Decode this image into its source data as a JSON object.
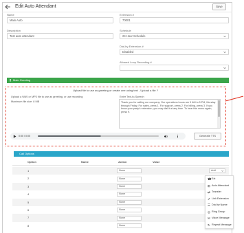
{
  "header": {
    "title": "Edit Auto Attendant",
    "back_icon": "arrow-left-icon",
    "save_label": "Save"
  },
  "form": {
    "name": {
      "label": "Name",
      "value": "Main Auto"
    },
    "description": {
      "label": "Description",
      "value": "Test auto attendant"
    },
    "extension": {
      "label": "Extension #",
      "value": "70001"
    },
    "schedule": {
      "label": "Schedule",
      "value": "24 Hour Schedule"
    },
    "dial_out": {
      "label": "Dial-by-Extension #",
      "value": "Disabled"
    },
    "loop": {
      "label": "Allowed Loop Recording #",
      "value": ""
    }
  },
  "greeting": {
    "bar_label": "Main Greeting",
    "intro": "Upload file to use as greeting or create one using text - Upload a file ?",
    "upload_hint": "Upload a WAV or MP3 file to use as greeting, or use recording",
    "max_size": "Maximum file size: 8 MB",
    "tts_label": "Enter Text-to-Speech",
    "tts_text": "Thank you for calling our company. Our operations hours are 9 AM to 5 PM, Monday through Friday. For sales, press 1. For support, press 2. For billing, press 3. If you know your party's extension, you may dial it at any time. To hear this menu again, press 9.",
    "player_time": "0:00 / 0:00",
    "generate_label": "Generate TTS"
  },
  "options": {
    "title": "Call Options",
    "columns": [
      "Option",
      "Name",
      "Action",
      "Value"
    ],
    "rows": [
      {
        "digit": "1",
        "action": "None"
      },
      {
        "digit": "2",
        "action": "None"
      },
      {
        "digit": "3",
        "action": "None"
      },
      {
        "digit": "4",
        "action": "None"
      },
      {
        "digit": "5",
        "action": "None"
      },
      {
        "digit": "6",
        "action": "None"
      },
      {
        "digit": "7",
        "action": "None"
      },
      {
        "digit": "8",
        "action": "None"
      }
    ],
    "add_label": "Add",
    "menu": [
      {
        "label": "Ext",
        "icon": "phone-icon"
      },
      {
        "label": "Auto Attendant",
        "icon": "auto-attendant-icon"
      },
      {
        "label": "Transfer",
        "icon": "transfer-icon"
      },
      {
        "label": "Link Extension",
        "icon": "link-icon"
      },
      {
        "label": "Dial by Name",
        "icon": "directory-icon"
      },
      {
        "label": "Ring Group",
        "icon": "ring-group-icon"
      },
      {
        "label": "Voice Message",
        "icon": "voicemail-icon"
      },
      {
        "label": "Repeat Message",
        "icon": "repeat-icon"
      }
    ]
  },
  "colors": {
    "greeting_bar": "#3ba54a",
    "options_bar": "#2aa6c9",
    "annotation": "#e0301e"
  }
}
